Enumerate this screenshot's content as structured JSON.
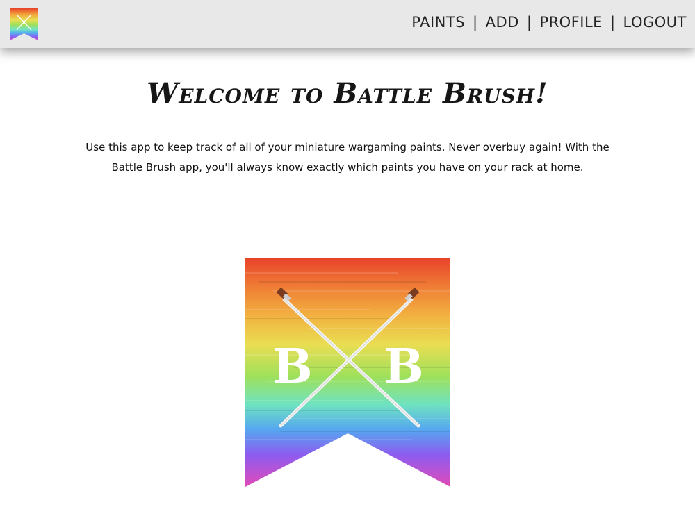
{
  "nav": {
    "links": [
      {
        "label": "PAINTS"
      },
      {
        "label": "ADD"
      },
      {
        "label": "PROFILE"
      },
      {
        "label": "LOGOUT"
      }
    ],
    "separator": "|"
  },
  "main": {
    "title": "Welcome to Battle Brush!",
    "description": "Use this app to keep track of all of your miniature wargaming paints. Never overbuy again! With the Battle Brush app, you'll always know exactly which paints you have on your rack at home."
  },
  "logo": {
    "letters": [
      "B",
      "B"
    ]
  },
  "colors": {
    "navbar_bg": "#e8e8e8",
    "text": "#111111",
    "rainbow": [
      "#e8412a",
      "#f2a23a",
      "#e9de52",
      "#9ee05c",
      "#6fe3c0",
      "#56a7f0",
      "#8d5cf0",
      "#e14ab8"
    ]
  }
}
